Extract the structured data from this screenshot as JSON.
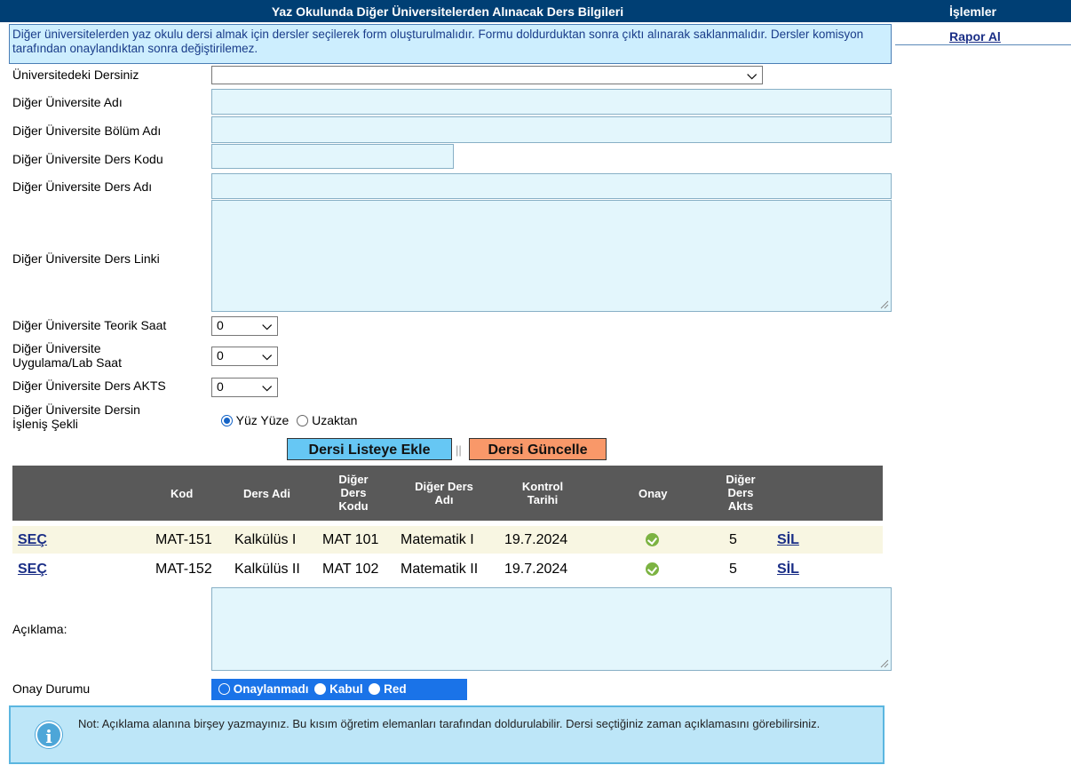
{
  "header": {
    "title": "Yaz Okulunda Diğer Üniversitelerden Alınacak Ders Bilgileri",
    "side_title": "İşlemler"
  },
  "sidebar": {
    "report_link": "Rapor Al"
  },
  "info": {
    "text": "Diğer üniversitelerden yaz okulu dersi almak için dersler seçilerek form oluşturulmalıdır. Formu doldurduktan sonra çıktı alınarak saklanmalıdır. Dersler komisyon tarafından onaylandıktan sonra değiştirilemez."
  },
  "form": {
    "course_label": "Üniversitedeki Dersiniz",
    "course_value": "",
    "uni_name_label": "Diğer Üniversite Adı",
    "dept_label": "Diğer Üniversite Bölüm Adı",
    "code_label": "Diğer Üniversite Ders Kodu",
    "name_label": "Diğer Üniversite Ders Adı",
    "link_label": "Diğer Üniversite Ders Linki",
    "theory_label": "Diğer Üniversite Teorik Saat",
    "theory_value": "0",
    "lab_label_line1": "Diğer Üniversite",
    "lab_label_line2": "Uygulama/Lab Saat",
    "lab_value": "0",
    "akts_label": "Diğer Üniversite Ders AKTS",
    "akts_value": "0",
    "mode_label_line1": "Diğer Üniversite Dersin",
    "mode_label_line2": "İşleniş Şekli",
    "mode_option1": "Yüz Yüze",
    "mode_option2": "Uzaktan",
    "add_button": "Dersi Listeye Ekle",
    "separator": "||",
    "update_button": "Dersi Güncelle"
  },
  "table": {
    "headers": {
      "kod": "Kod",
      "ders_adi": "Ders Adi",
      "diger_kodu": [
        "Diğer",
        "Ders",
        "Kodu"
      ],
      "diger_adi": [
        "Diğer Ders",
        "Adı"
      ],
      "kontrol": [
        "Kontrol",
        "Tarihi"
      ],
      "onay": "Onay",
      "akts": [
        "Diğer",
        "Ders",
        "Akts"
      ]
    },
    "rows": [
      {
        "select": "SEÇ",
        "kod": "MAT-151",
        "ders_adi": "Kalkülüs I",
        "diger_kodu": "MAT 101",
        "diger_adi": "Matematik I",
        "tarih": "19.7.2024",
        "akts": "5",
        "delete": "SİL"
      },
      {
        "select": "SEÇ",
        "kod": "MAT-152",
        "ders_adi": "Kalkülüs II",
        "diger_kodu": "MAT 102",
        "diger_adi": "Matematik II",
        "tarih": "19.7.2024",
        "akts": "5",
        "delete": "SİL"
      }
    ]
  },
  "comment": {
    "label": "Açıklama:"
  },
  "approval": {
    "label": "Onay Durumu",
    "option1": "Onaylanmadı",
    "option2": "Kabul",
    "option3": "Red"
  },
  "note": {
    "text": "Not: Açıklama alanına birşey yazmayınız. Bu kısım öğretim elemanları tarafından doldurulabilir. Dersi seçtiğiniz zaman açıklamasını görebilirsiniz."
  },
  "colors": {
    "header_bg": "#003f74",
    "add_button": "#66c7f4",
    "update_button": "#f99869",
    "approval_bg": "#1a73e8"
  }
}
